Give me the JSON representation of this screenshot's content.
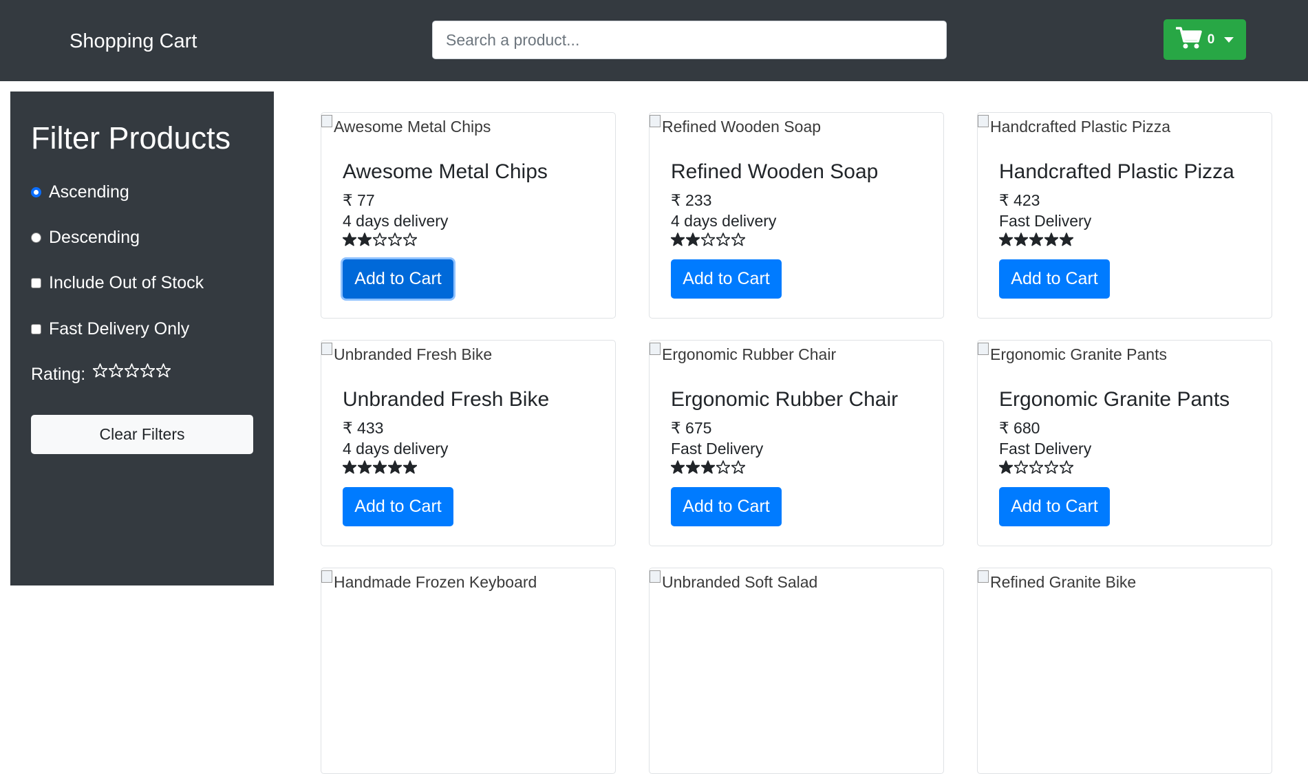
{
  "header": {
    "brand": "Shopping Cart",
    "search_placeholder": "Search a product...",
    "cart_count": "0",
    "cart_icon": "shopping-cart-icon",
    "dropdown_icon": "caret-down-icon"
  },
  "sidebar": {
    "title": "Filter Products",
    "options": [
      {
        "label": "Ascending",
        "type": "radio",
        "checked": true
      },
      {
        "label": "Descending",
        "type": "radio",
        "checked": false
      },
      {
        "label": "Include Out of Stock",
        "type": "checkbox",
        "checked": false
      },
      {
        "label": "Fast Delivery Only",
        "type": "checkbox",
        "checked": false
      }
    ],
    "rating_label": "Rating:",
    "rating_value": 0,
    "clear_label": "Clear Filters"
  },
  "products": [
    {
      "name": "Awesome Metal Chips",
      "price": "₹ 77",
      "delivery": "4 days delivery",
      "rating": 2,
      "button": "Add to Cart"
    },
    {
      "name": "Refined Wooden Soap",
      "price": "₹ 233",
      "delivery": "4 days delivery",
      "rating": 2,
      "button": "Add to Cart"
    },
    {
      "name": "Handcrafted Plastic Pizza",
      "price": "₹ 423",
      "delivery": "Fast Delivery",
      "rating": 5,
      "button": "Add to Cart"
    },
    {
      "name": "Unbranded Fresh Bike",
      "price": "₹ 433",
      "delivery": "4 days delivery",
      "rating": 5,
      "button": "Add to Cart"
    },
    {
      "name": "Ergonomic Rubber Chair",
      "price": "₹ 675",
      "delivery": "Fast Delivery",
      "rating": 3,
      "button": "Add to Cart"
    },
    {
      "name": "Ergonomic Granite Pants",
      "price": "₹ 680",
      "delivery": "Fast Delivery",
      "rating": 1,
      "button": "Add to Cart"
    },
    {
      "name": "Handmade Frozen Keyboard"
    },
    {
      "name": "Unbranded Soft Salad"
    },
    {
      "name": "Refined Granite Bike"
    }
  ],
  "colors": {
    "navbar": "#343a40",
    "cart_button": "#28a745",
    "primary": "#007bff"
  }
}
